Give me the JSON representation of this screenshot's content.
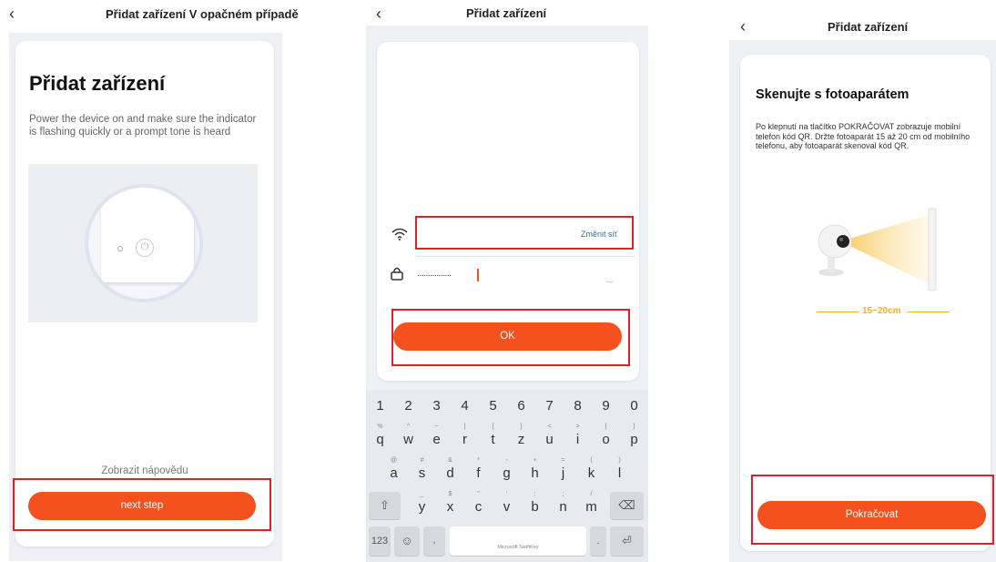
{
  "screen1": {
    "back_icon": "chevron-left-icon",
    "title": "Přidat zařízení  V opačném případě",
    "heading": "Přidat zařízení",
    "description": "Power the device on and make sure the indicator is flashing quickly or a prompt tone is heard",
    "help_link": "Zobrazit nápovědu",
    "next_button": "next step"
  },
  "screen2": {
    "back_icon": "chevron-left-icon",
    "title": "Přidat zařízení",
    "change_network": "Změnit síť",
    "password_masked": "················",
    "ok_button": "OK",
    "keyboard": {
      "numbers": [
        "1",
        "2",
        "3",
        "4",
        "5",
        "6",
        "7",
        "8",
        "9",
        "0"
      ],
      "row1": [
        {
          "k": "q",
          "s": "%"
        },
        {
          "k": "w",
          "s": "^"
        },
        {
          "k": "e",
          "s": "~"
        },
        {
          "k": "r",
          "s": "|"
        },
        {
          "k": "t",
          "s": "["
        },
        {
          "k": "z",
          "s": "]"
        },
        {
          "k": "u",
          "s": "<"
        },
        {
          "k": "i",
          "s": ">"
        },
        {
          "k": "o",
          "s": "{"
        },
        {
          "k": "p",
          "s": "}"
        }
      ],
      "row2": [
        {
          "k": "a",
          "s": "@"
        },
        {
          "k": "s",
          "s": "#"
        },
        {
          "k": "d",
          "s": "&"
        },
        {
          "k": "f",
          "s": "*"
        },
        {
          "k": "g",
          "s": "-"
        },
        {
          "k": "h",
          "s": "+"
        },
        {
          "k": "j",
          "s": "="
        },
        {
          "k": "k",
          "s": "("
        },
        {
          "k": "l",
          "s": ")"
        }
      ],
      "row3": [
        {
          "k": "y",
          "s": "_"
        },
        {
          "k": "x",
          "s": "$"
        },
        {
          "k": "c",
          "s": "\""
        },
        {
          "k": "v",
          "s": "'"
        },
        {
          "k": "b",
          "s": ":"
        },
        {
          "k": "n",
          "s": ";"
        },
        {
          "k": "m",
          "s": "/"
        }
      ],
      "key_123": "123",
      "space_label": "Microsoft SwiftKey"
    }
  },
  "screen3": {
    "back_icon": "chevron-left-icon",
    "title": "Přidat zařízení",
    "heading": "Skenujte s fotoaparátem",
    "description": "Po klepnutí na tlačítko POKRAČOVAT zobrazuje mobilní telefon kód QR. Držte fotoaparát 15 až 20 cm od mobilního telefonu, aby fotoaparát skenoval kód QR.",
    "distance_label": "15~20cm",
    "continue_button": "Pokračovat"
  },
  "colors": {
    "accent": "#f4511e",
    "highlight": "#e01f2b",
    "link": "#2a6db5",
    "measure": "#f2b21e"
  }
}
